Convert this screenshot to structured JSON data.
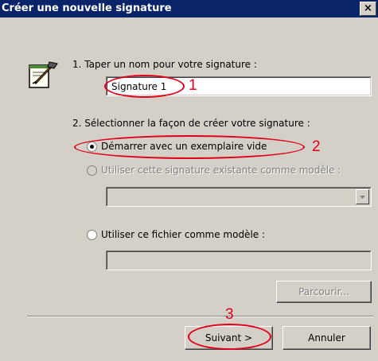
{
  "window": {
    "title": "Créer une nouvelle signature",
    "close_label": "×"
  },
  "step1": {
    "label": "1. Taper un nom pour votre signature :",
    "name_value": "Signature 1"
  },
  "step2": {
    "label": "2. Sélectionner la façon de créer votre signature :",
    "options": [
      {
        "label": "Démarrer avec un exemplaire vide",
        "selected": true,
        "enabled": true
      },
      {
        "label": "Utiliser cette signature existante comme modèle :",
        "selected": false,
        "enabled": false
      },
      {
        "label": "Utiliser ce fichier comme modèle :",
        "selected": false,
        "enabled": true
      }
    ],
    "existing_select_value": "",
    "file_path_value": ""
  },
  "buttons": {
    "browse": "Parcourir...",
    "next": "Suivant >",
    "cancel": "Annuler"
  },
  "annotations": [
    "1",
    "2",
    "3"
  ],
  "colors": {
    "title_bar": "#0a246a",
    "dialog_bg": "#d4d0c8",
    "annotation": "#e0001c"
  },
  "icons": {
    "wizard": "signature-pen-icon",
    "select_arrow": "chevron-down-icon"
  }
}
